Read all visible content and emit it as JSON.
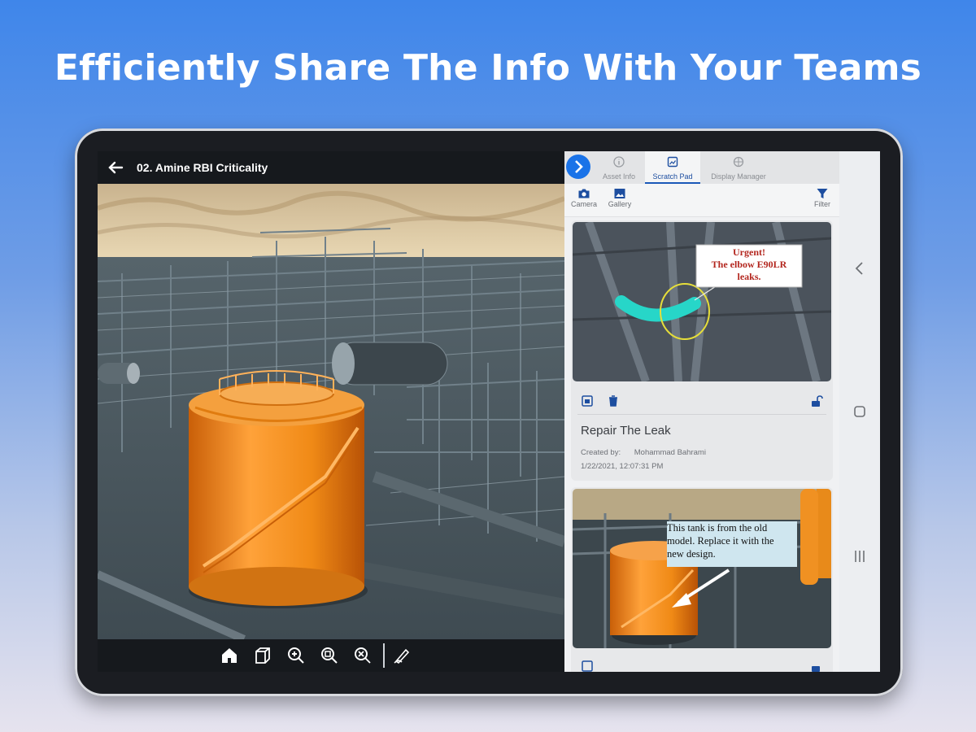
{
  "headline": "Efficiently Share The Info With Your Teams",
  "viewer": {
    "title": "02. Amine RBI Criticality"
  },
  "panel": {
    "tabs": [
      {
        "label": "Asset Info",
        "icon": "info-icon"
      },
      {
        "label": "Scratch Pad",
        "icon": "scratch-pad-icon",
        "active": true
      },
      {
        "label": "Display Manager",
        "icon": "display-manager-icon"
      }
    ],
    "actions": {
      "camera": "Camera",
      "gallery": "Gallery",
      "filter": "Filter"
    },
    "cards": [
      {
        "title": "Repair The Leak",
        "created_by_label": "Created by:",
        "author": "Mohammad Bahrami",
        "timestamp": "1/22/2021, 12:07:31 PM",
        "annotation": [
          "Urgent!",
          "The elbow E90LR",
          "leaks."
        ]
      },
      {
        "annotation": [
          "This tank is from the old",
          "model. Replace it with the",
          "new design."
        ]
      }
    ]
  },
  "colors": {
    "accent": "#1a73e8",
    "tank": "#f0901e",
    "pipe_highlight": "#27d6c8"
  }
}
